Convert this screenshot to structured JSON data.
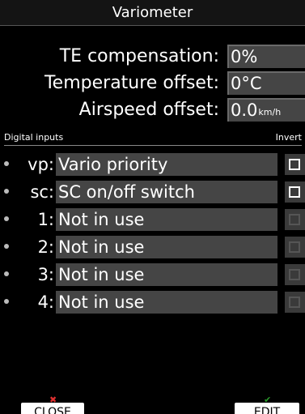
{
  "title": "Variometer",
  "settings": [
    {
      "label": "TE compensation:",
      "value": "0%",
      "unit": ""
    },
    {
      "label": "Temperature offset:",
      "value": "0°C",
      "unit": ""
    },
    {
      "label": "Airspeed offset:",
      "value": "0.0",
      "unit": "km/h"
    }
  ],
  "section": {
    "left": "Digital inputs",
    "right": "Invert"
  },
  "inputs": [
    {
      "code": "vp:",
      "value": "Vario priority",
      "enabled": true
    },
    {
      "code": "sc:",
      "value": "SC on/off switch",
      "enabled": true
    },
    {
      "code": "1:",
      "value": "Not in use",
      "enabled": false
    },
    {
      "code": "2:",
      "value": "Not in use",
      "enabled": false
    },
    {
      "code": "3:",
      "value": "Not in use",
      "enabled": false
    },
    {
      "code": "4:",
      "value": "Not in use",
      "enabled": false
    }
  ],
  "buttons": {
    "close": "CLOSE",
    "edit": "EDIT"
  },
  "colors": {
    "close_icon": "#e03030",
    "edit_icon": "#2a9a2a"
  },
  "icons": {
    "close": "close-x-icon",
    "edit": "checkmark-icon"
  }
}
